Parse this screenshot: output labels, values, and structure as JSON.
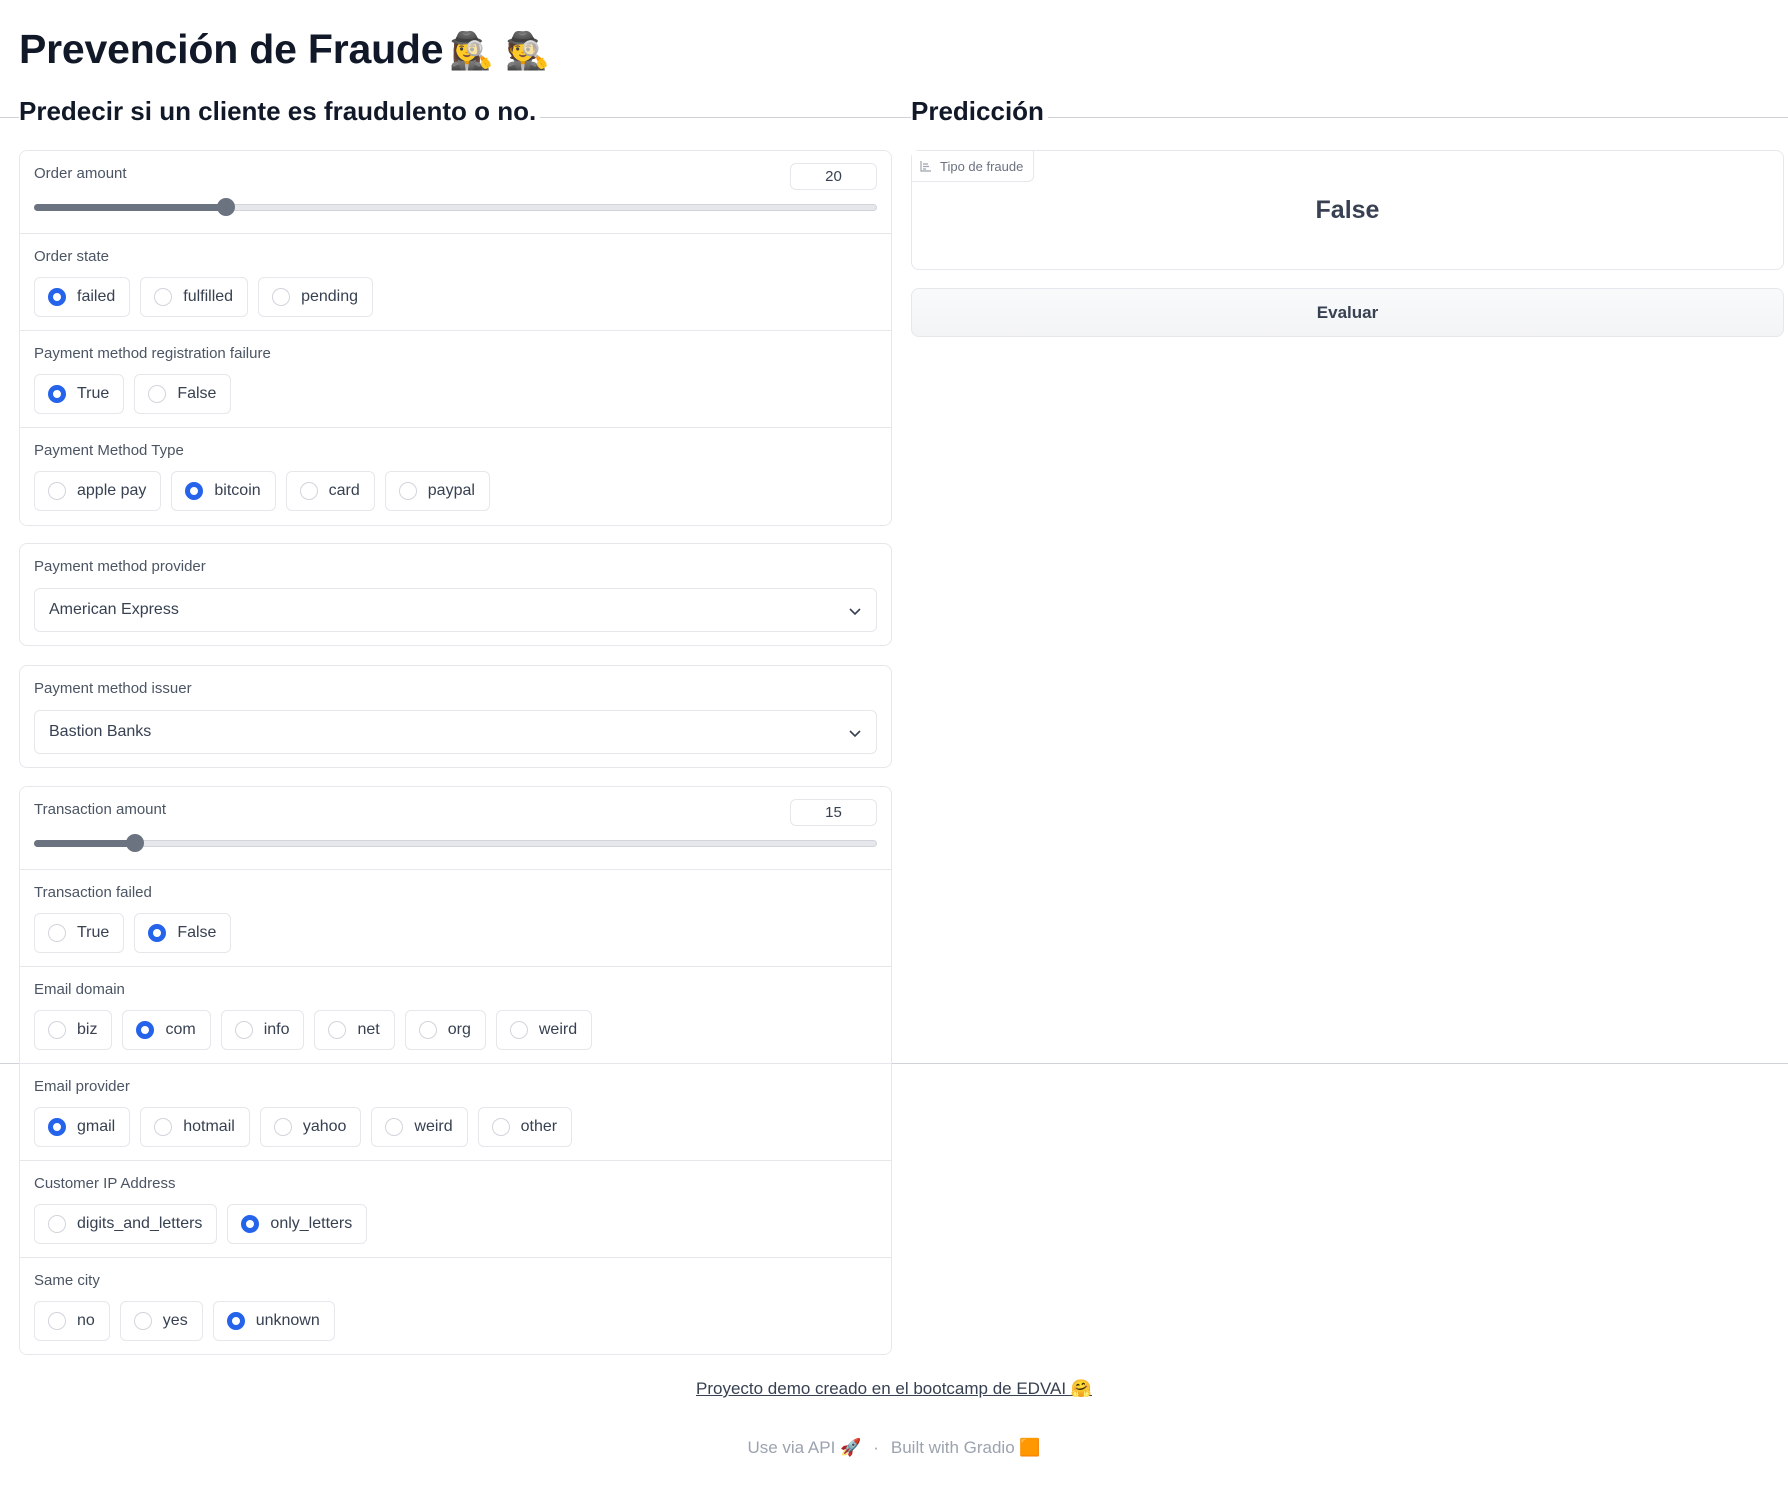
{
  "header": {
    "title": "Prevención de Fraude",
    "title_emoji": "🕵️‍♀️ 🕵️",
    "subtitle": "Predecir si un cliente es fraudulento o no.",
    "prediction_title": "Predicción"
  },
  "inputs": {
    "order_amount": {
      "label": "Order amount",
      "value": "20",
      "fraction": 0.228
    },
    "order_state": {
      "label": "Order state",
      "options": [
        "failed",
        "fulfilled",
        "pending"
      ],
      "selected": "failed"
    },
    "payment_reg_failure": {
      "label": "Payment method registration failure",
      "options": [
        "True",
        "False"
      ],
      "selected": "True"
    },
    "payment_method_type": {
      "label": "Payment Method Type",
      "options": [
        "apple pay",
        "bitcoin",
        "card",
        "paypal"
      ],
      "selected": "bitcoin"
    },
    "payment_provider": {
      "label": "Payment method provider",
      "value": "American Express"
    },
    "payment_issuer": {
      "label": "Payment method issuer",
      "value": "Bastion Banks"
    },
    "transaction_amount": {
      "label": "Transaction amount",
      "value": "15",
      "fraction": 0.12
    },
    "transaction_failed": {
      "label": "Transaction failed",
      "options": [
        "True",
        "False"
      ],
      "selected": "False"
    },
    "email_domain": {
      "label": "Email domain",
      "options": [
        "biz",
        "com",
        "info",
        "net",
        "org",
        "weird"
      ],
      "selected": "com"
    },
    "email_provider": {
      "label": "Email provider",
      "options": [
        "gmail",
        "hotmail",
        "yahoo",
        "weird",
        "other"
      ],
      "selected": "gmail"
    },
    "customer_ip": {
      "label": "Customer IP Address",
      "options": [
        "digits_and_letters",
        "only_letters"
      ],
      "selected": "only_letters"
    },
    "same_city": {
      "label": "Same city",
      "options": [
        "no",
        "yes",
        "unknown"
      ],
      "selected": "unknown"
    }
  },
  "output": {
    "label": "Tipo de fraude",
    "value": "False"
  },
  "evaluate_button": "Evaluar",
  "footer": {
    "project_link": "Proyecto demo creado en el bootcamp de EDVAI 🤗",
    "api_link": "Use via API 🚀",
    "separator": "·",
    "built_with": "Built with Gradio 🟧"
  },
  "colors": {
    "accent": "#2563eb",
    "border": "#e5e7eb",
    "slider": "#6b7280"
  }
}
